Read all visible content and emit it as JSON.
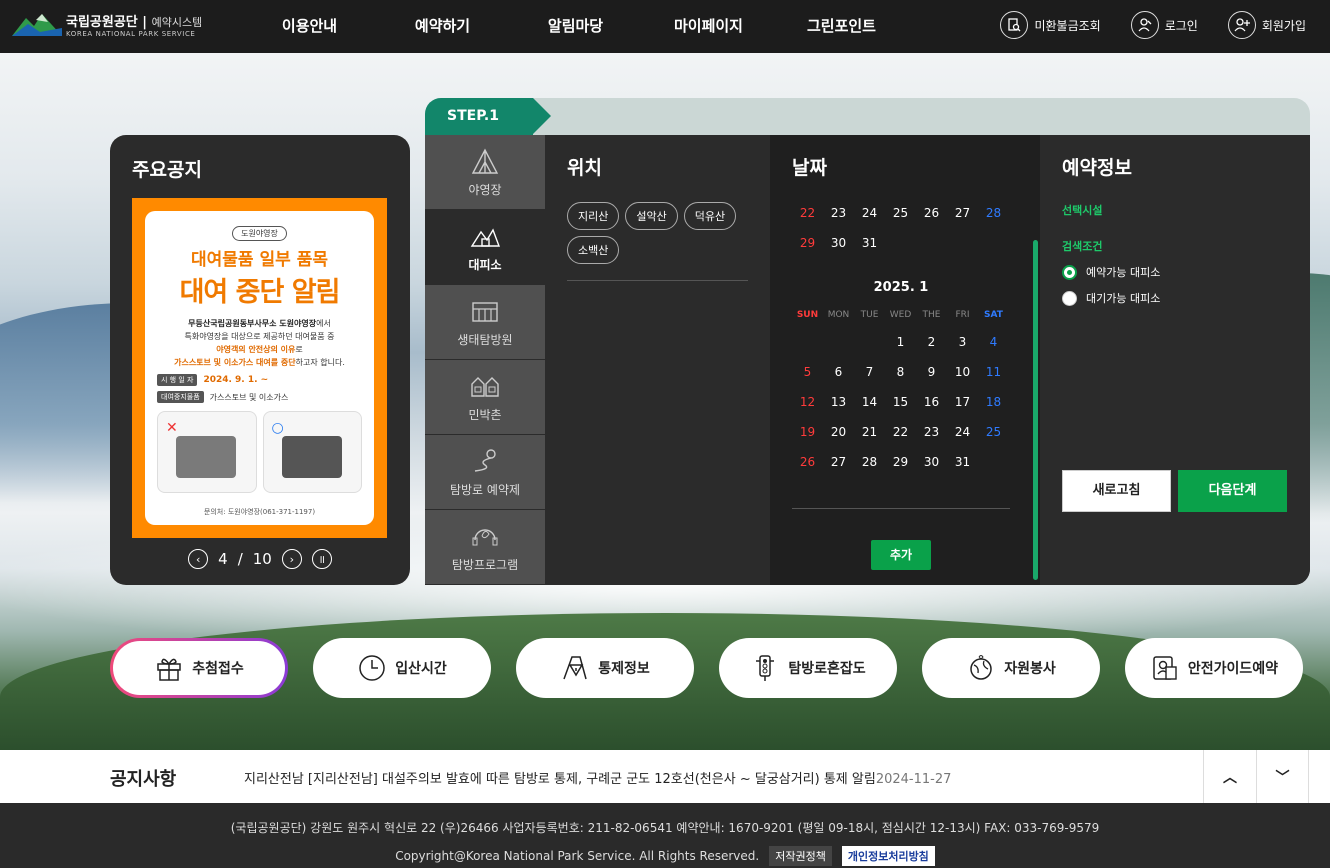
{
  "header": {
    "logo_title": "국립공원공단",
    "logo_sub": "예약시스템",
    "logo_en": "KOREA NATIONAL PARK SERVICE",
    "nav": [
      "이용안내",
      "예약하기",
      "알림마당",
      "마이페이지",
      "그린포인트"
    ],
    "util": [
      "미환불금조회",
      "로그인",
      "회원가입"
    ]
  },
  "notice": {
    "title": "주요공지",
    "poster": {
      "pill": "도원야영장",
      "h1": "대여물품 일부 품목",
      "h2": "대여 중단 알림",
      "line1": "무등산국립공원동부사무소 도원야영장",
      "line1b": "에서",
      "line2": "특화야영장을 대상으로 제공하던 대여물품 중",
      "line3a": "야영객의 안전상의 이유",
      "line3b": "로",
      "line4a": "가스스토브 및 이소가스 대여를 중단",
      "line4b": "하고자 합니다.",
      "label1": "시 행 일 자",
      "date": "2024. 9. 1. ~",
      "label2": "대여중지물품",
      "items": "가스스토브 및 이소가스",
      "contact": "문의처: 도원야영장(061-371-1197)"
    },
    "page_current": "4",
    "page_sep": "/",
    "page_total": "10"
  },
  "step": {
    "label": "STEP.1"
  },
  "categories": [
    {
      "label": "야영장",
      "icon": "tent-icon"
    },
    {
      "label": "대피소",
      "icon": "shelter-icon"
    },
    {
      "label": "생태탐방원",
      "icon": "building-icon"
    },
    {
      "label": "민박촌",
      "icon": "houses-icon"
    },
    {
      "label": "탐방로 예약제",
      "icon": "trail-icon"
    },
    {
      "label": "탐방프로그램",
      "icon": "program-icon"
    }
  ],
  "location": {
    "title": "위치",
    "chips": [
      "지리산",
      "설악산",
      "덕유산",
      "소백산"
    ]
  },
  "date": {
    "title": "날짜",
    "prev_rows": [
      [
        "22",
        "23",
        "24",
        "25",
        "26",
        "27",
        "28"
      ],
      [
        "29",
        "30",
        "31",
        "",
        "",
        "",
        "",
        ""
      ]
    ],
    "month_title": "2025. 1",
    "weekdays": [
      "SUN",
      "MON",
      "TUE",
      "WED",
      "THE",
      "FRI",
      "SAT"
    ],
    "rows": [
      [
        "",
        "",
        "",
        "1",
        "2",
        "3",
        "4"
      ],
      [
        "5",
        "6",
        "7",
        "8",
        "9",
        "10",
        "11"
      ],
      [
        "12",
        "13",
        "14",
        "15",
        "16",
        "17",
        "18"
      ],
      [
        "19",
        "20",
        "21",
        "22",
        "23",
        "24",
        "25"
      ],
      [
        "26",
        "27",
        "28",
        "29",
        "30",
        "31",
        ""
      ]
    ],
    "add_label": "추가"
  },
  "info": {
    "title": "예약정보",
    "selected": "선택시설",
    "condition": "검색조건",
    "opt1": "예약가능 대피소",
    "opt2": "대기가능 대피소",
    "refresh": "새로고침",
    "next": "다음단계"
  },
  "quick": [
    "추첨접수",
    "입산시간",
    "통제정보",
    "탐방로혼잡도",
    "자원봉사",
    "안전가이드예약"
  ],
  "noticebar": {
    "title": "공지사항",
    "msg": "지리산전남 [지리산전남] 대설주의보 발효에 따른 탐방로 통제, 구례군 군도 12호선(천은사 ~ 달궁삼거리) 통제 알림",
    "date": "2024-11-27"
  },
  "footer": {
    "address": "(국립공원공단) 강원도 원주시 혁신로 22 (우)26466   사업자등록번호: 211-82-06541   예약안내: 1670-9201 (평일 09-18시, 점심시간 12-13시)   FAX: 033-769-9579",
    "copyright": "Copyright@Korea National Park Service. All Rights Reserved.",
    "link1": "저작권정책",
    "link2": "개인정보처리방침"
  }
}
